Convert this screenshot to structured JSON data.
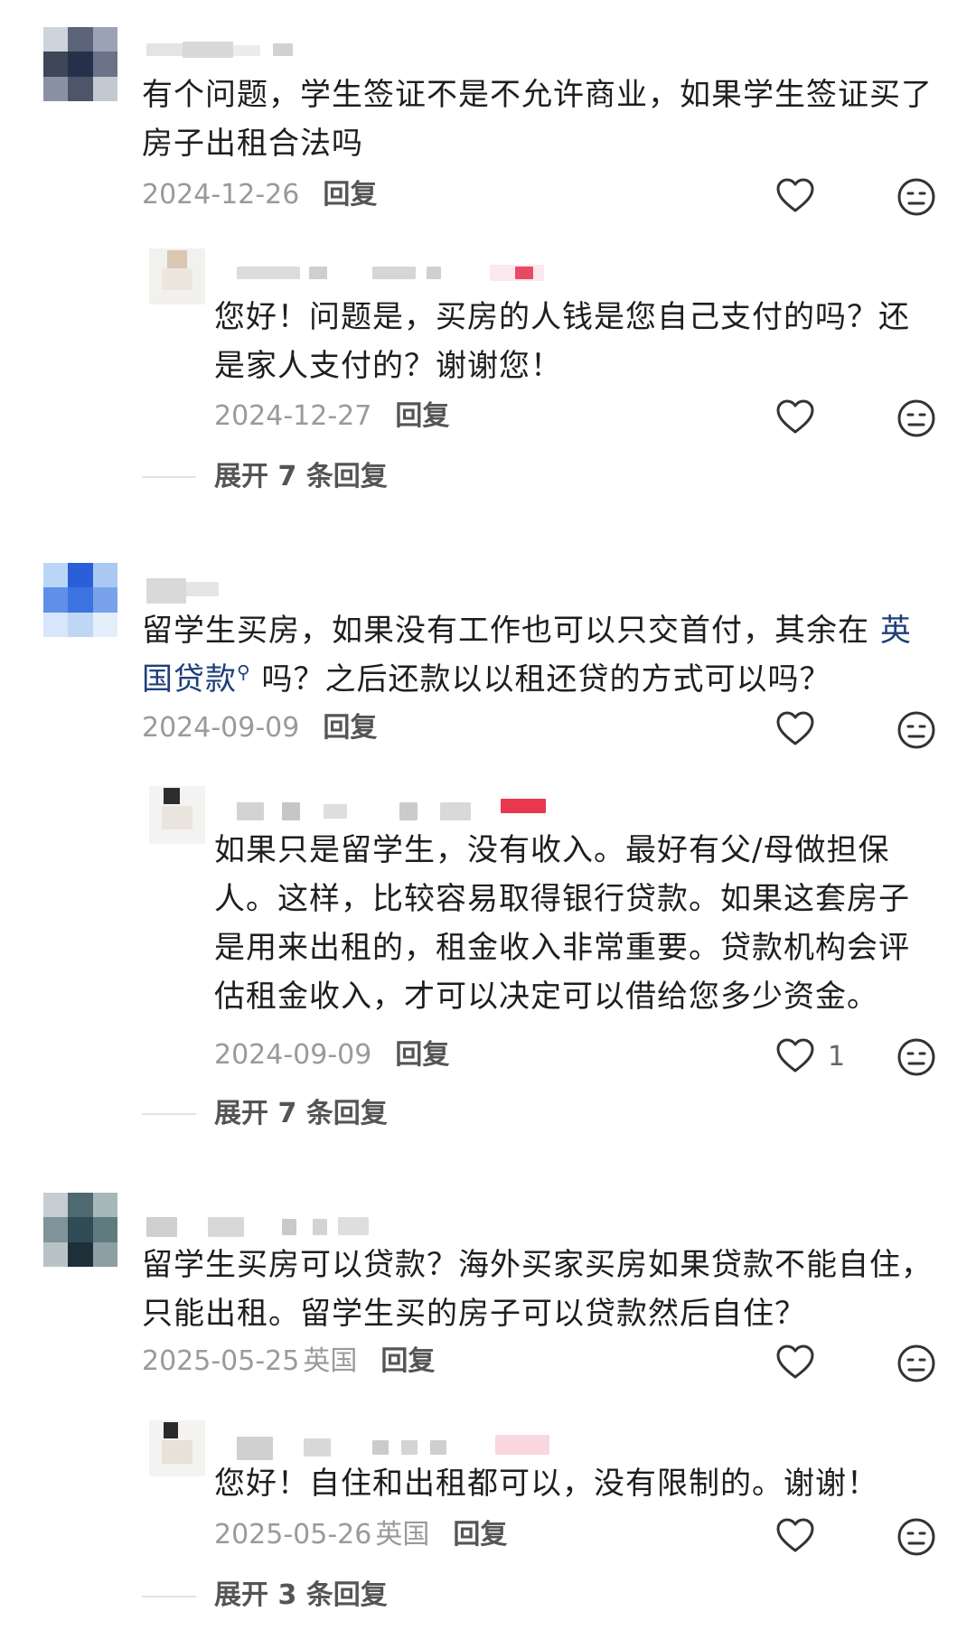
{
  "comments": [
    {
      "text": "有个问题，学生签证不是不允许商业，如果学生签证买了房子出租合法吗",
      "date": "2024-12-26",
      "location": "",
      "reply_label": "回复",
      "replies": [
        {
          "text": "您好！问题是，买房的人钱是您自己支付的吗？还是家人支付的？谢谢您！",
          "date": "2024-12-27",
          "location": "",
          "reply_label": "回复",
          "like_count": ""
        }
      ],
      "expand_label": "展开 7 条回复"
    },
    {
      "text_before": "留学生买房，如果没有工作也可以只交首付，其余在 ",
      "link_text": "英国贷款",
      "text_after": " 吗？之后还款以以租还贷的方式可以吗？",
      "date": "2024-09-09",
      "location": "",
      "reply_label": "回复",
      "replies": [
        {
          "text": "如果只是留学生，没有收入。最好有父/母做担保人。这样，比较容易取得银行贷款。如果这套房子是用来出租的，租金收入非常重要。贷款机构会评估租金收入，才可以决定可以借给您多少资金。",
          "date": "2024-09-09",
          "location": "",
          "reply_label": "回复",
          "like_count": "1"
        }
      ],
      "expand_label": "展开 7 条回复"
    },
    {
      "text": "留学生买房可以贷款？海外买家买房如果贷款不能自住，只能出租。留学生买的房子可以贷款然后自住？",
      "date": "2025-05-25",
      "location": "英国",
      "reply_label": "回复",
      "replies": [
        {
          "text": "您好！自住和出租都可以，没有限制的。谢谢！",
          "date": "2025-05-26",
          "location": "英国",
          "reply_label": "回复",
          "like_count": ""
        }
      ],
      "expand_label": "展开 3 条回复"
    }
  ],
  "icons": {
    "like": "heart-outline-icon",
    "dislike": "frown-face-icon",
    "search_link": "search-icon"
  },
  "colors": {
    "link": "#1f3f7a",
    "meta": "#9a9a9a",
    "text": "#1e1e1e"
  }
}
